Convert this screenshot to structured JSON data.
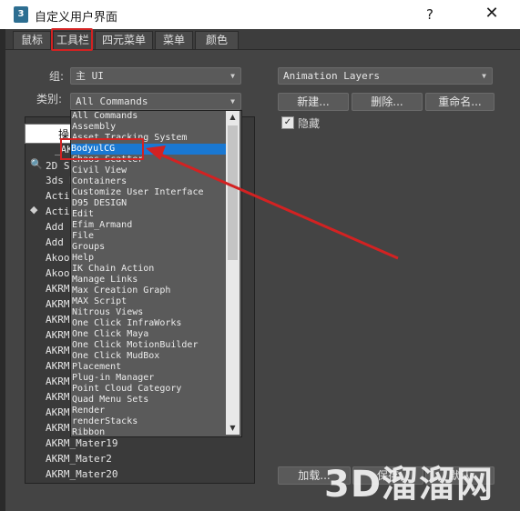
{
  "window": {
    "title": "自定义用户界面",
    "app_icon_label": "3",
    "help_label": "?",
    "close_label": "✕"
  },
  "tabs": [
    {
      "label": "鼠标",
      "active": false
    },
    {
      "label": "工具栏",
      "active": true
    },
    {
      "label": "四元菜单",
      "active": false
    },
    {
      "label": "菜单",
      "active": false
    },
    {
      "label": "颜色",
      "active": false
    }
  ],
  "left_panel": {
    "group_label": "组:",
    "group_value": "主 UI",
    "category_label": "类别:",
    "category_value": "All Commands",
    "list_header_partial": "操",
    "commands": [
      "_AK",
      "2D S",
      "3ds M",
      "Activ",
      "Activ",
      "Add t",
      "Add t",
      "Akoo",
      "Akoo",
      "AKRM",
      "AKRM",
      "AKRM",
      "AKRM",
      "AKRM",
      "AKRM",
      "AKRM",
      "AKRM",
      "AKRM",
      "AKRM",
      "AKRM_Mater19",
      "AKRM_Mater2",
      "AKRM_Mater20"
    ],
    "category_options": [
      "All Commands",
      "Assembly",
      "Asset Tracking System",
      "BodyulCG",
      "Chaos Scatter",
      "Civil View",
      "Containers",
      "Customize User Interface",
      "D95 DESIGN",
      "Edit",
      "Efim_Armand",
      "File",
      "Groups",
      "Help",
      "IK Chain Action",
      "Manage Links",
      "Max Creation Graph",
      "MAX Script",
      "Nitrous Views",
      "One Click InfraWorks",
      "One Click Maya",
      "One Click MotionBuilder",
      "One Click MudBox",
      "Placement",
      "Plug-in Manager",
      "Point Cloud Category",
      "Quad Menu Sets",
      "Render",
      "renderStacks",
      "Ribbon"
    ],
    "selected_option": "BodyulCG",
    "load_button": "加载..."
  },
  "right_panel": {
    "toolbar_value": "Animation Layers",
    "new_button": "新建...",
    "delete_button": "删除...",
    "rename_button": "重命名...",
    "hide_label": "隐藏",
    "hide_checked": true,
    "save_button_partial": "保存",
    "set_button_partial": "默认"
  },
  "watermark": "3D溜溜网",
  "colors": {
    "background": "#444444",
    "highlight_red": "#d32222",
    "selection_blue": "#1a78d2"
  }
}
